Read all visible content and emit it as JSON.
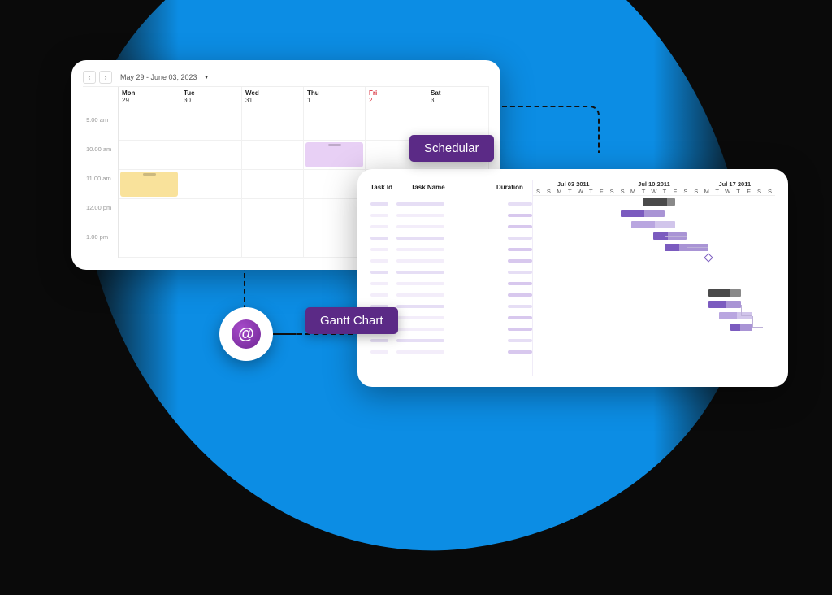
{
  "labels": {
    "scheduler": "Schedular",
    "gantt": "Gantt Chart"
  },
  "scheduler": {
    "date_range": "May 29 - June 03, 2023",
    "days": [
      {
        "dow": "Mon",
        "num": "29"
      },
      {
        "dow": "Tue",
        "num": "30"
      },
      {
        "dow": "Wed",
        "num": "31"
      },
      {
        "dow": "Thu",
        "num": "1"
      },
      {
        "dow": "Fri",
        "num": "2"
      },
      {
        "dow": "Sat",
        "num": "3"
      }
    ],
    "times": [
      "9.00 am",
      "10.00 am",
      "11.00 am",
      "12.00 pm",
      "1.00 pm"
    ],
    "events": [
      {
        "row": 2,
        "col": 4,
        "color": "purple"
      },
      {
        "row": 3,
        "col": 1,
        "color": "yellow"
      }
    ]
  },
  "gantt": {
    "columns": {
      "id": "Task Id",
      "name": "Task Name",
      "duration": "Duration"
    },
    "weeks": [
      "Jul 03 2011",
      "Jul 10 2011",
      "Jul 17 2011"
    ],
    "day_letters": [
      "S",
      "S",
      "M",
      "T",
      "W",
      "T",
      "F",
      "S",
      "S",
      "M",
      "T",
      "W",
      "T",
      "F",
      "S",
      "S",
      "M",
      "T",
      "W",
      "T",
      "F",
      "S",
      "S"
    ],
    "row_count": 14,
    "bars": [
      {
        "row": 0,
        "start": 10,
        "span": 3,
        "color": "grey",
        "pct": 0.7
      },
      {
        "row": 1,
        "start": 8,
        "span": 4,
        "color": "purp",
        "pct": 0.5
      },
      {
        "row": 2,
        "start": 9,
        "span": 4,
        "color": "lpurp",
        "pct": 0.5
      },
      {
        "row": 3,
        "start": 11,
        "span": 3,
        "color": "purp",
        "pct": 0.4
      },
      {
        "row": 4,
        "start": 12,
        "span": 4,
        "color": "purp",
        "pct": 0.3
      },
      {
        "row": 8,
        "start": 16,
        "span": 3,
        "color": "grey",
        "pct": 0.6
      },
      {
        "row": 9,
        "start": 16,
        "span": 3,
        "color": "purp",
        "pct": 0.5
      },
      {
        "row": 10,
        "start": 17,
        "span": 3,
        "color": "lpurp",
        "pct": 0.5
      },
      {
        "row": 11,
        "start": 18,
        "span": 2,
        "color": "purp",
        "pct": 0.4
      }
    ],
    "milestone": {
      "row": 5,
      "col": 16
    }
  },
  "colors": {
    "accent_bg": "#0c8de4",
    "tag_bg": "#5b2a86",
    "bar_purple": "#7b5bbf",
    "bar_light_purple": "#b9a6e0",
    "bar_grey": "#4a4a4a"
  }
}
